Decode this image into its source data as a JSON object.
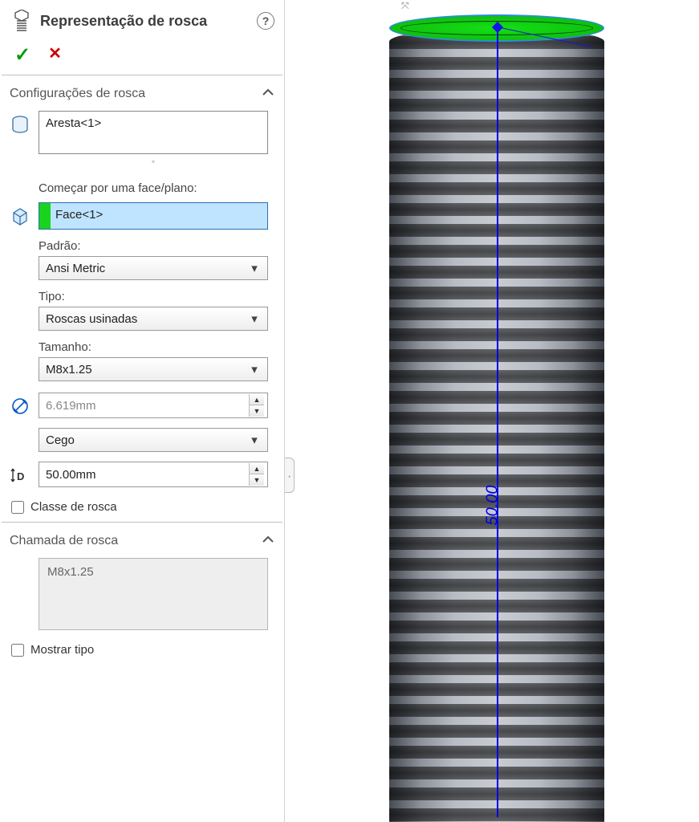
{
  "header": {
    "title": "Representação de rosca"
  },
  "sections": {
    "config": {
      "title": "Configurações de rosca"
    },
    "callout": {
      "title": "Chamada de rosca"
    }
  },
  "edge_selection": {
    "value": "Aresta<1>"
  },
  "start_from": {
    "label": "Começar por uma face/plano:",
    "value": "Face<1>"
  },
  "standard": {
    "label": "Padrão:",
    "value": "Ansi Metric"
  },
  "type": {
    "label": "Tipo:",
    "value": "Roscas usinadas"
  },
  "size": {
    "label": "Tamanho:",
    "value": "M8x1.25"
  },
  "diameter": {
    "value": "6.619mm"
  },
  "end_condition": {
    "value": "Cego"
  },
  "depth": {
    "value": "50.00mm"
  },
  "thread_class": {
    "label": "Classe de rosca"
  },
  "callout_text": {
    "value": "M8x1.25"
  },
  "show_type": {
    "label": "Mostrar tipo"
  },
  "viewport": {
    "dimension_label": "50.00"
  }
}
